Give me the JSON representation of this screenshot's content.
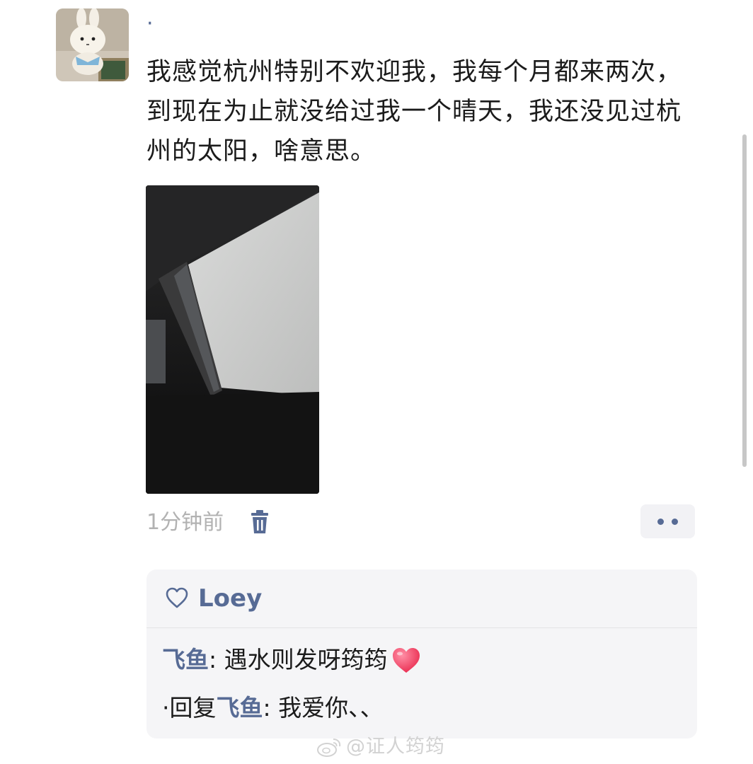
{
  "post": {
    "nickname": "·",
    "text": "我感觉杭州特别不欢迎我，我每个月都来两次，到现在为止就没给过我一个晴天，我还没见过杭州的太阳，啥意思。",
    "time": "1分钟前"
  },
  "icons": {
    "avatar": "avatar-plush-bunny",
    "photo": "car-window-photo",
    "delete": "trash-icon",
    "more": "more-dots-icon",
    "like": "heart-outline-icon",
    "emoji": "red-heart-emoji",
    "watermark": "weibo-icon"
  },
  "likes": {
    "names": "Loey"
  },
  "comments": [
    {
      "author": "飞鱼",
      "separator": ": ",
      "text": "遇水则发呀筠筠"
    },
    {
      "prefix": "·回复",
      "target": "飞鱼",
      "separator": ": ",
      "text": "我爱你、、"
    }
  ],
  "watermark": {
    "text": "@证人筠筠"
  },
  "colors": {
    "link": "#576b95",
    "meta": "#b2b2b2",
    "panel": "#f5f5f7",
    "text": "#1b1b1b"
  }
}
